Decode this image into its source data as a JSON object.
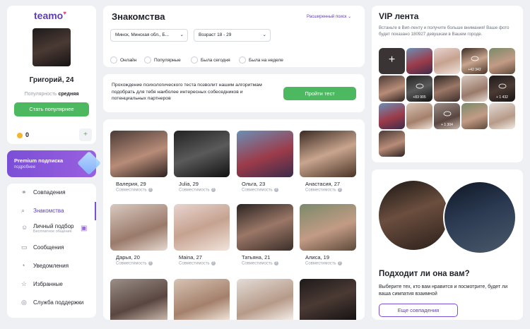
{
  "logo": "teamo",
  "profile": {
    "name": "Григорий, 24",
    "popularity_label": "Популярность",
    "popularity_value": "средняя",
    "become_popular": "Стать популярнее",
    "coins": "0",
    "add": "+"
  },
  "premium": {
    "title": "Premium подписка",
    "subtitle": "подробнее"
  },
  "sidebar": {
    "items": [
      {
        "label": "Совпадения",
        "icon": "hearts-icon"
      },
      {
        "label": "Знакомства",
        "icon": "search-icon"
      },
      {
        "label": "Личный подбор",
        "sub": "Бесплатное общение",
        "icon": "person-icon"
      },
      {
        "label": "Сообщения",
        "icon": "chat-icon"
      },
      {
        "label": "Уведомления",
        "icon": "bell-icon"
      },
      {
        "label": "Избранные",
        "icon": "star-icon"
      },
      {
        "label": "Служба поддержки",
        "icon": "support-icon"
      }
    ]
  },
  "search": {
    "title": "Знакомства",
    "advanced": "Расширенный поиск",
    "location": "Минск, Минская обл., Б...",
    "age": "Возраст 18 - 29",
    "filters": [
      "Онлайн",
      "Популярные",
      "Была сегодня",
      "Была на неделе"
    ]
  },
  "test_banner": {
    "text": "Прохождение психологического теста позволит нашим алгоритмам подобрать для тебя наиболее интересных собеседников и потенциальных партнеров",
    "button": "Пройти тест"
  },
  "compat_label": "Совместимость",
  "people": [
    {
      "name": "Валерия, 29"
    },
    {
      "name": "Julia, 29"
    },
    {
      "name": "Ольга, 23"
    },
    {
      "name": "Анастасия, 27"
    },
    {
      "name": "Дарья, 20"
    },
    {
      "name": "Maina, 27"
    },
    {
      "name": "Татьяна, 21"
    },
    {
      "name": "Алиса, 19"
    },
    {
      "name": ""
    },
    {
      "name": ""
    },
    {
      "name": ""
    },
    {
      "name": ""
    }
  ],
  "vip": {
    "title": "VIP лента",
    "text": "Встаньте в Вип-ленту и получите больше внимания! Ваше фото будет показано 180927 девушкам в Вашем городе.",
    "add": "+",
    "counts": [
      "+42 342",
      "+83 905",
      "+ 1 432",
      "+ 1 304"
    ]
  },
  "match": {
    "title": "Подходит ли она вам?",
    "text": "Выберите тех, кто вам нравится и посмотрите, будет ли ваша симпатия взаимной",
    "button": "Еще совпадения"
  },
  "colors": {
    "accent": "#7a4fd6",
    "green": "#4cb85f",
    "pink": "#e8487a"
  }
}
